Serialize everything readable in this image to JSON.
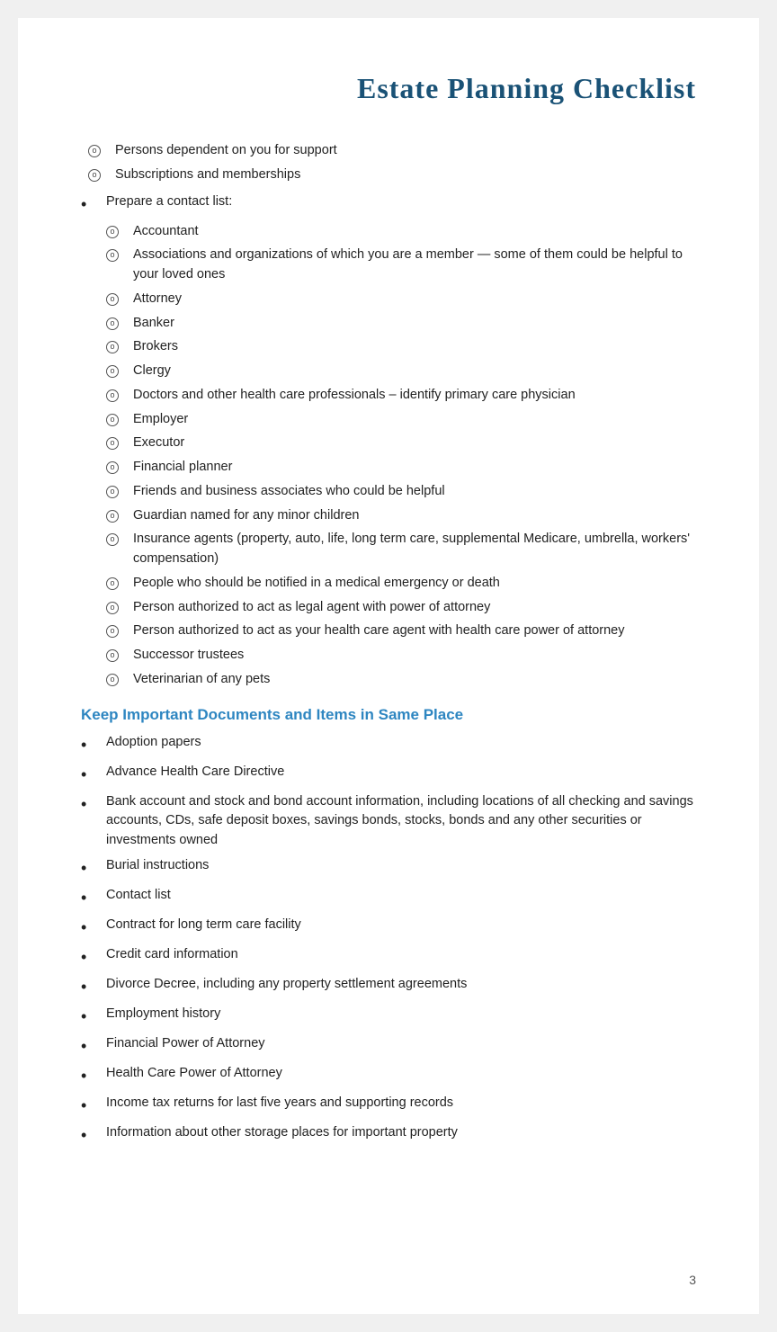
{
  "header": {
    "title": "Estate Planning Checklist"
  },
  "page_number": "3",
  "circle_items_top": [
    {
      "text": "Persons dependent on you for support"
    },
    {
      "text": "Subscriptions and memberships"
    }
  ],
  "bullet_items_prepare": [
    {
      "text": "Prepare a contact list:"
    }
  ],
  "circle_items_contact": [
    {
      "text": "Accountant"
    },
    {
      "text": "Associations and organizations of which you are a member — some of them could be helpful to your loved ones"
    },
    {
      "text": "Attorney"
    },
    {
      "text": "Banker"
    },
    {
      "text": "Brokers"
    },
    {
      "text": "Clergy"
    },
    {
      "text": "Doctors and other health care professionals – identify primary care physician"
    },
    {
      "text": "Employer"
    },
    {
      "text": "Executor"
    },
    {
      "text": "Financial planner"
    },
    {
      "text": "Friends and business associates who could be helpful"
    },
    {
      "text": "Guardian named for any minor children"
    },
    {
      "text": "Insurance agents (property, auto, life, long term care, supplemental Medicare, umbrella, workers' compensation)"
    },
    {
      "text": "People who should be notified in a medical emergency or death"
    },
    {
      "text": "Person authorized to act as legal agent with power of attorney"
    },
    {
      "text": "Person authorized to act as your health care agent with health care power of attorney"
    },
    {
      "text": "Successor trustees"
    },
    {
      "text": "Veterinarian of any pets"
    }
  ],
  "section_keep": {
    "heading": "Keep Important Documents and Items in Same Place",
    "items": [
      {
        "text": "Adoption papers"
      },
      {
        "text": "Advance Health Care Directive"
      },
      {
        "text": "Bank account and stock and bond account information, including locations of all checking and savings accounts, CDs, safe deposit boxes, savings bonds, stocks, bonds and any other securities or investments owned"
      },
      {
        "text": "Burial instructions"
      },
      {
        "text": "Contact list"
      },
      {
        "text": "Contract for long term care facility"
      },
      {
        "text": "Credit card information"
      },
      {
        "text": "Divorce Decree, including any property settlement agreements"
      },
      {
        "text": "Employment history"
      },
      {
        "text": "Financial Power of Attorney"
      },
      {
        "text": "Health Care Power of Attorney"
      },
      {
        "text": "Income tax returns for last five years and supporting records"
      },
      {
        "text": "Information about other storage places for important property"
      }
    ]
  }
}
